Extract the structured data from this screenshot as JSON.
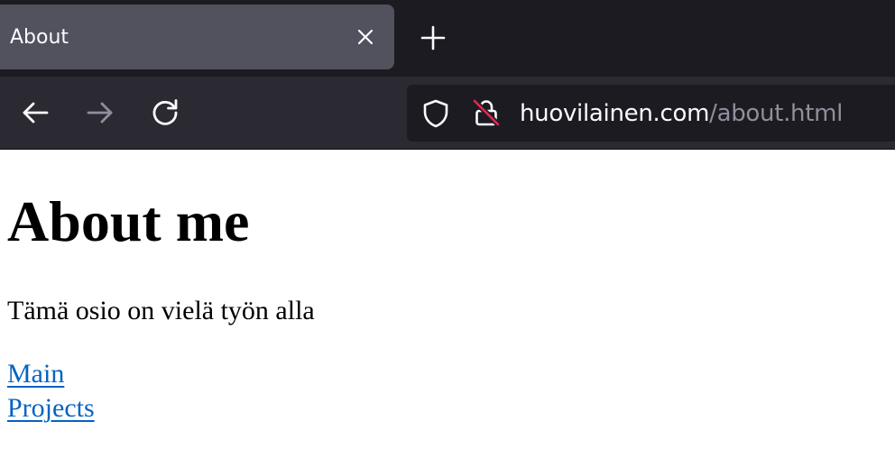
{
  "browser": {
    "tab": {
      "title": "About",
      "close_icon": "close-icon"
    },
    "new_tab_icon": "plus-icon",
    "navigation": {
      "back_icon": "arrow-left-icon",
      "forward_icon": "arrow-right-icon",
      "reload_icon": "reload-icon",
      "forward_enabled": false
    },
    "address_bar": {
      "host": "huovilainen.com",
      "path": "/about.html",
      "tracking_icon": "shield-icon",
      "security_icon": "insecure-lock-icon"
    },
    "colors": {
      "tab_strip": "#1c1b22",
      "active_tab": "#52515e",
      "toolbar": "#2b2a33",
      "url_host": "#fbfbfe",
      "url_path": "#8f8f9d",
      "insecure_slash": "#e22850",
      "link": "#0563c1"
    }
  },
  "page": {
    "heading": "About me",
    "paragraph": "Tämä osio on vielä työn alla",
    "links": [
      {
        "label": "Main"
      },
      {
        "label": "Projects"
      }
    ]
  }
}
